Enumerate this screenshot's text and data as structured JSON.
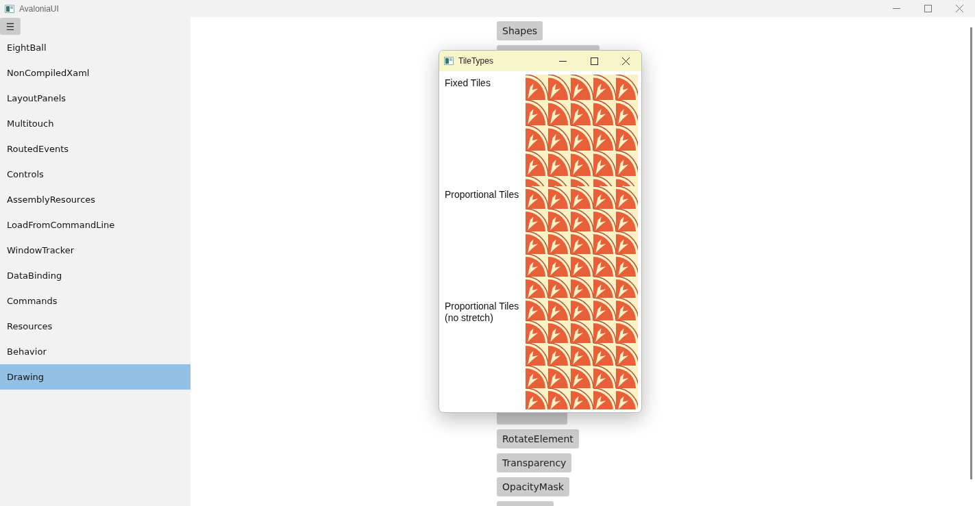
{
  "window": {
    "title": "AvaloniaUI"
  },
  "sidebar": {
    "menu_button": "☰",
    "items": [
      {
        "label": "EightBall",
        "selected": false
      },
      {
        "label": "NonCompiledXaml",
        "selected": false
      },
      {
        "label": "LayoutPanels",
        "selected": false
      },
      {
        "label": "Multitouch",
        "selected": false
      },
      {
        "label": "RoutedEvents",
        "selected": false
      },
      {
        "label": "Controls",
        "selected": false
      },
      {
        "label": "AssemblyResources",
        "selected": false
      },
      {
        "label": "LoadFromCommandLine",
        "selected": false
      },
      {
        "label": "WindowTracker",
        "selected": false
      },
      {
        "label": "DataBinding",
        "selected": false
      },
      {
        "label": "Commands",
        "selected": false
      },
      {
        "label": "Resources",
        "selected": false
      },
      {
        "label": "Behavior",
        "selected": false
      },
      {
        "label": "Drawing",
        "selected": true
      }
    ]
  },
  "buttons_top": [
    {
      "kind": "text",
      "label": "Shapes"
    },
    {
      "kind": "covered"
    }
  ],
  "buttons_bottom": [
    {
      "kind": "partial"
    },
    {
      "kind": "text",
      "label": "RotateElement"
    },
    {
      "kind": "text",
      "label": "Transparency"
    },
    {
      "kind": "text",
      "label": "OpacityMask"
    },
    {
      "kind": "cut"
    }
  ],
  "dialog": {
    "title": "TileTypes",
    "sections": [
      {
        "label": "Fixed Tiles"
      },
      {
        "label": "Proportional Tiles"
      },
      {
        "label": "Proportional Tiles\n(no stretch)"
      }
    ]
  }
}
